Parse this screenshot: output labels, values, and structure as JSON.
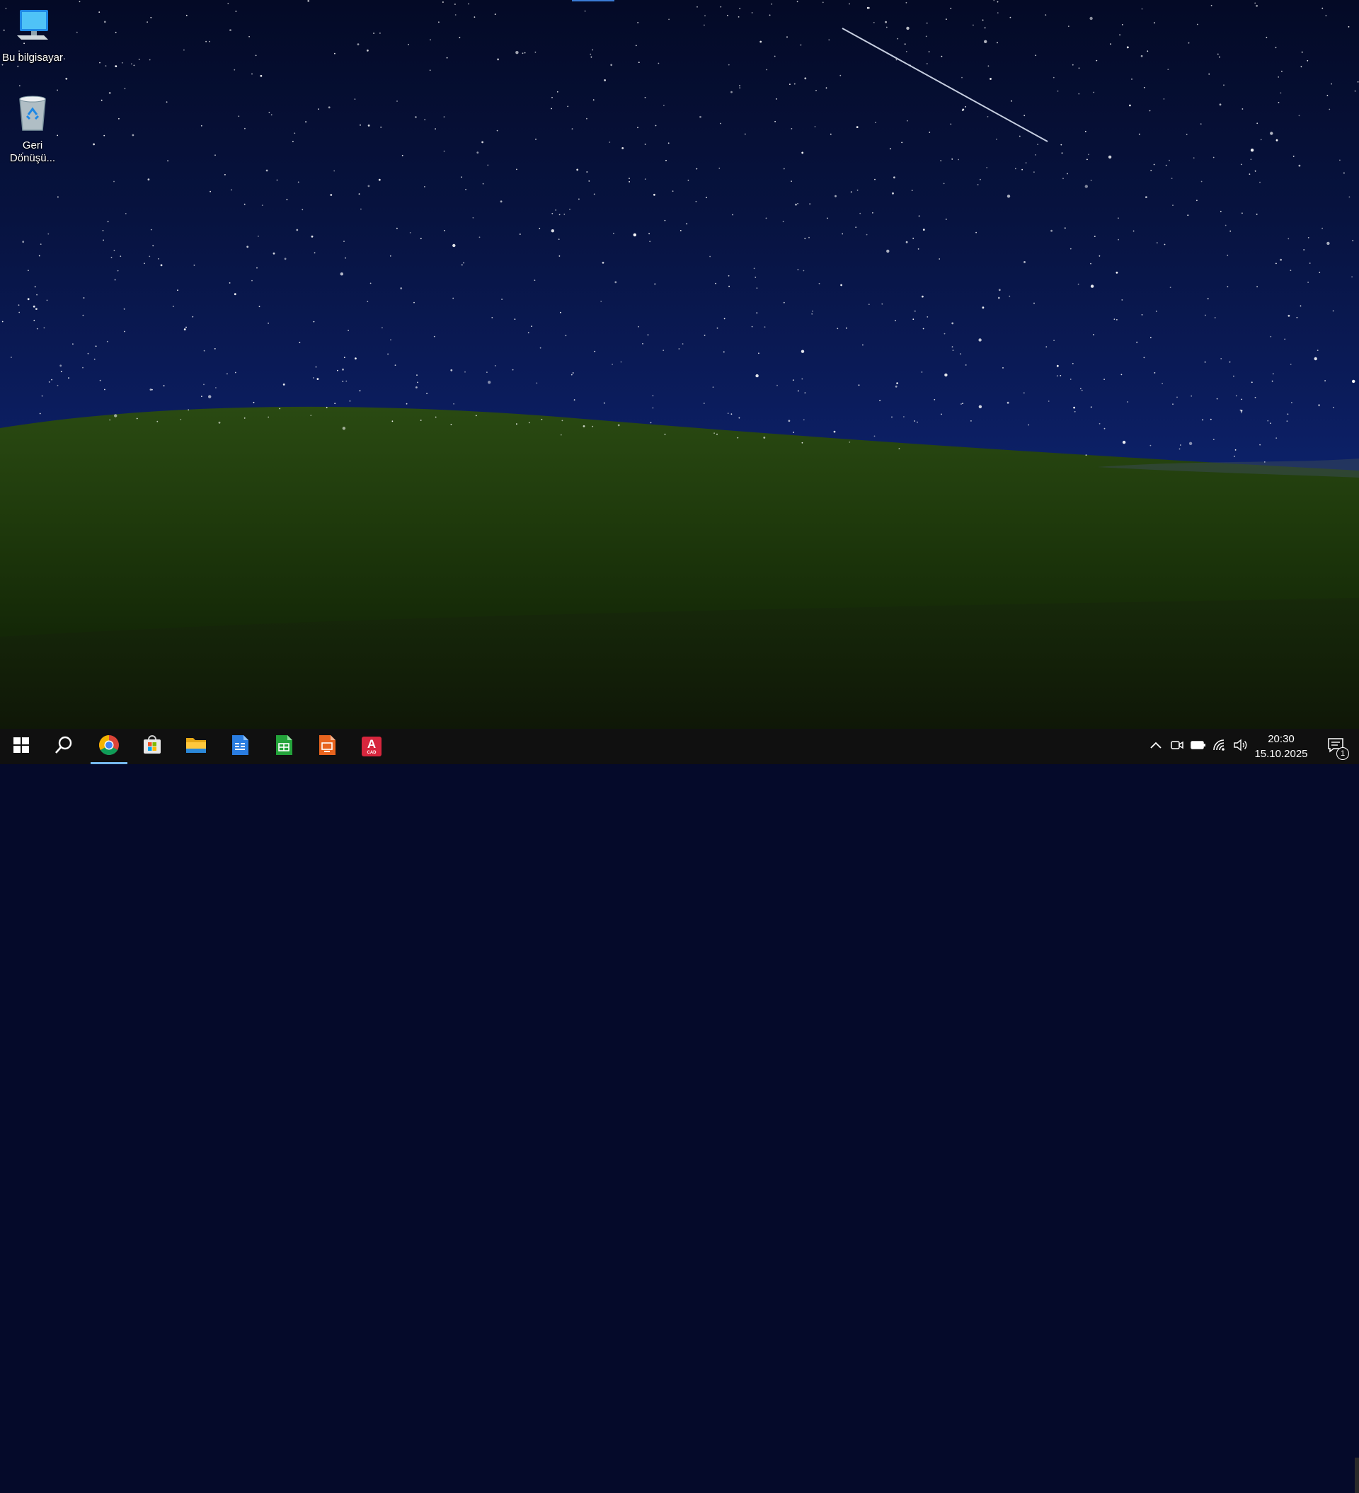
{
  "desktop": {
    "icons": [
      {
        "label": "Bu bilgisayar",
        "icon": "this-pc-icon"
      },
      {
        "label": "Geri Dönüşü...",
        "icon": "recycle-bin-icon"
      }
    ],
    "colors": {
      "sky": "#071340",
      "hill": "#1f3a0c"
    }
  },
  "taskbar": {
    "apps": [
      {
        "name": "start-icon"
      },
      {
        "name": "search-icon"
      },
      {
        "name": "chrome-icon",
        "active": true
      },
      {
        "name": "microsoft-store-icon"
      },
      {
        "name": "file-explorer-icon"
      },
      {
        "name": "writer-document-icon"
      },
      {
        "name": "spreadsheet-icon"
      },
      {
        "name": "presentation-icon"
      },
      {
        "name": "cad-app-icon",
        "badge_text": "A",
        "sub_text": "CAD"
      }
    ],
    "tray": {
      "icons": [
        "chevron-up-icon",
        "meet-now-icon",
        "battery-icon",
        "wifi-icon",
        "volume-icon"
      ],
      "time": "20:30",
      "date": "15.10.2025",
      "notification_count": "1"
    }
  }
}
